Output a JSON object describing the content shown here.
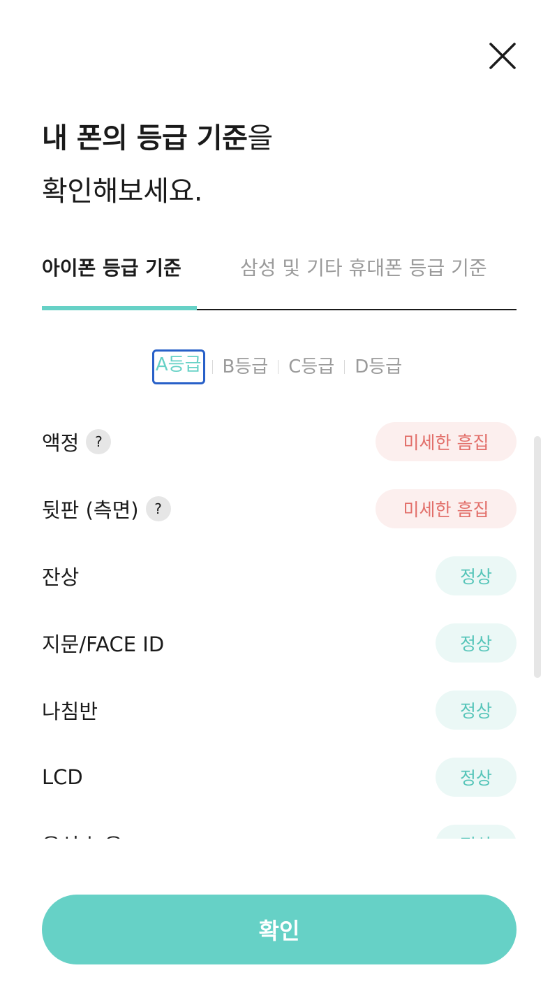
{
  "header": {
    "close_icon": "close-icon"
  },
  "title": {
    "line1_strong": "내 폰의 등급 기준",
    "line1_rest": "을",
    "line2": "확인해보세요."
  },
  "tabs": [
    {
      "label": "아이폰 등급 기준",
      "active": true
    },
    {
      "label": "삼성 및 기타 휴대폰 등급 기준",
      "active": false
    }
  ],
  "grades": [
    {
      "label": "A등급",
      "active": true
    },
    {
      "label": "B등급",
      "active": false
    },
    {
      "label": "C등급",
      "active": false
    },
    {
      "label": "D등급",
      "active": false
    }
  ],
  "criteria": [
    {
      "label": "액정",
      "help": "?",
      "status": "미세한 흠집",
      "type": "scratch"
    },
    {
      "label": "뒷판 (측면)",
      "help": "?",
      "status": "미세한 흠집",
      "type": "scratch"
    },
    {
      "label": "잔상",
      "status": "정상",
      "type": "normal"
    },
    {
      "label": "지문/FACE ID",
      "status": "정상",
      "type": "normal"
    },
    {
      "label": "나침반",
      "status": "정상",
      "type": "normal"
    },
    {
      "label": "LCD",
      "status": "정상",
      "type": "normal"
    },
    {
      "label": "음성 녹음",
      "status": "정상",
      "type": "normal"
    }
  ],
  "colors": {
    "accent": "#66d1c6",
    "scratch_text": "#e26f6a",
    "scratch_bg": "#fcefee",
    "normal_text": "#56c5b9",
    "normal_bg": "#ebf8f6"
  },
  "footer": {
    "confirm_label": "확인"
  }
}
